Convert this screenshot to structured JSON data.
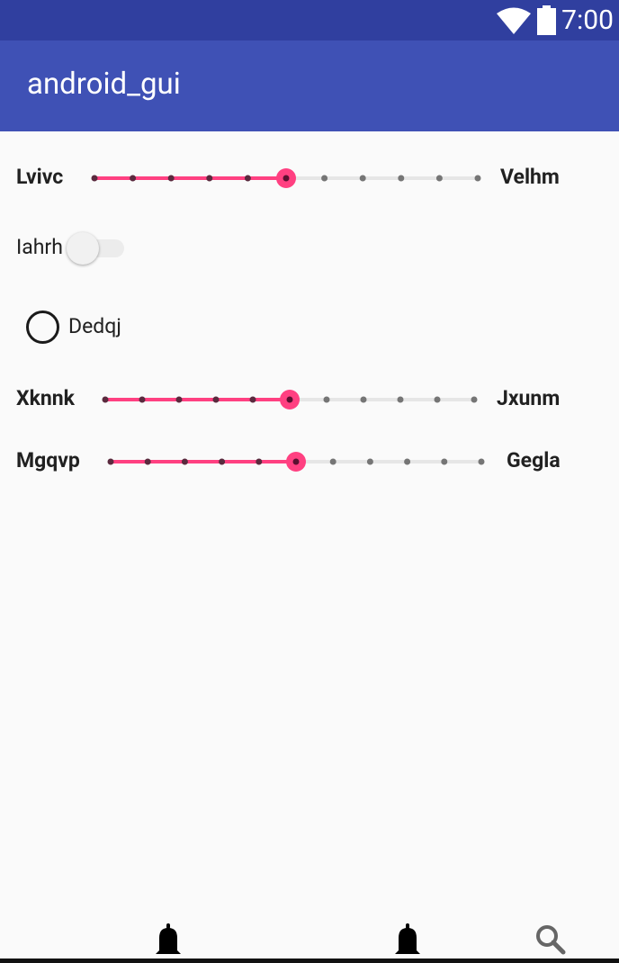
{
  "status_bar": {
    "time": "7:00",
    "icons": [
      "wifi-icon",
      "battery-icon"
    ]
  },
  "app_bar": {
    "title": "android_gui"
  },
  "sliders": [
    {
      "left_label": "Lvivc",
      "right_label": "Velhm",
      "steps": 10,
      "value": 5
    },
    {
      "left_label": "Xknnk",
      "right_label": "Jxunm",
      "steps": 10,
      "value": 5
    },
    {
      "left_label": "Mgqvp",
      "right_label": "Gegla",
      "steps": 10,
      "value": 5
    }
  ],
  "switch": {
    "label": "Iahrh",
    "checked": false
  },
  "radio": {
    "label": "Dedqj",
    "checked": false
  },
  "bottom_nav": {
    "items": [
      "bell-icon",
      "bell-icon",
      "search-icon"
    ]
  },
  "colors": {
    "status_bar": "#303f9f",
    "app_bar": "#3f51b5",
    "accent": "#ff4081",
    "background": "#fafafa"
  }
}
